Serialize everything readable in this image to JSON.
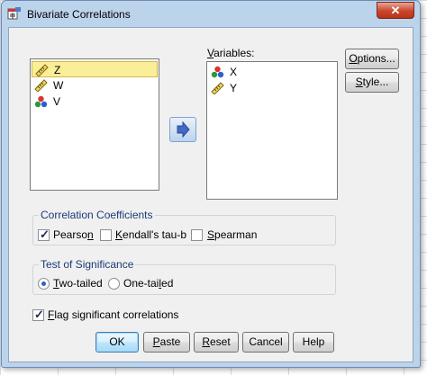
{
  "window": {
    "title": "Bivariate Correlations",
    "close_glyph": "✕"
  },
  "source_list": {
    "items": [
      {
        "label": "Z",
        "type": "scale",
        "selected": true
      },
      {
        "label": "W",
        "type": "scale",
        "selected": false
      },
      {
        "label": "V",
        "type": "nominal",
        "selected": false
      }
    ]
  },
  "variables": {
    "label": "Variables:",
    "items": [
      {
        "label": "X",
        "type": "nominal"
      },
      {
        "label": "Y",
        "type": "scale"
      }
    ]
  },
  "side_buttons": {
    "options": "Options...",
    "style": "Style..."
  },
  "coefficients": {
    "title": "Correlation Coefficients",
    "pearson": {
      "label": "Pearson",
      "checked": true
    },
    "kendall": {
      "label": "Kendall's tau-b",
      "checked": false
    },
    "spearman": {
      "label": "Spearman",
      "checked": false
    }
  },
  "significance": {
    "title": "Test of Significance",
    "two_tailed": {
      "label": "Two-tailed",
      "selected": true
    },
    "one_tailed": {
      "label": "One-tailed",
      "selected": false
    }
  },
  "flag": {
    "label": "Flag significant correlations",
    "checked": true
  },
  "buttons": {
    "ok": "OK",
    "paste": "Paste",
    "reset": "Reset",
    "cancel": "Cancel",
    "help": "Help"
  },
  "icons": {
    "scale": "ruler-icon",
    "nominal": "nominal-balls-icon",
    "move": "right-arrow-icon",
    "app": "spss-dialog-icon"
  },
  "colors": {
    "selection_fill": "#fbee98",
    "group_title": "#1a3a78",
    "arrow": "#4169c5"
  }
}
